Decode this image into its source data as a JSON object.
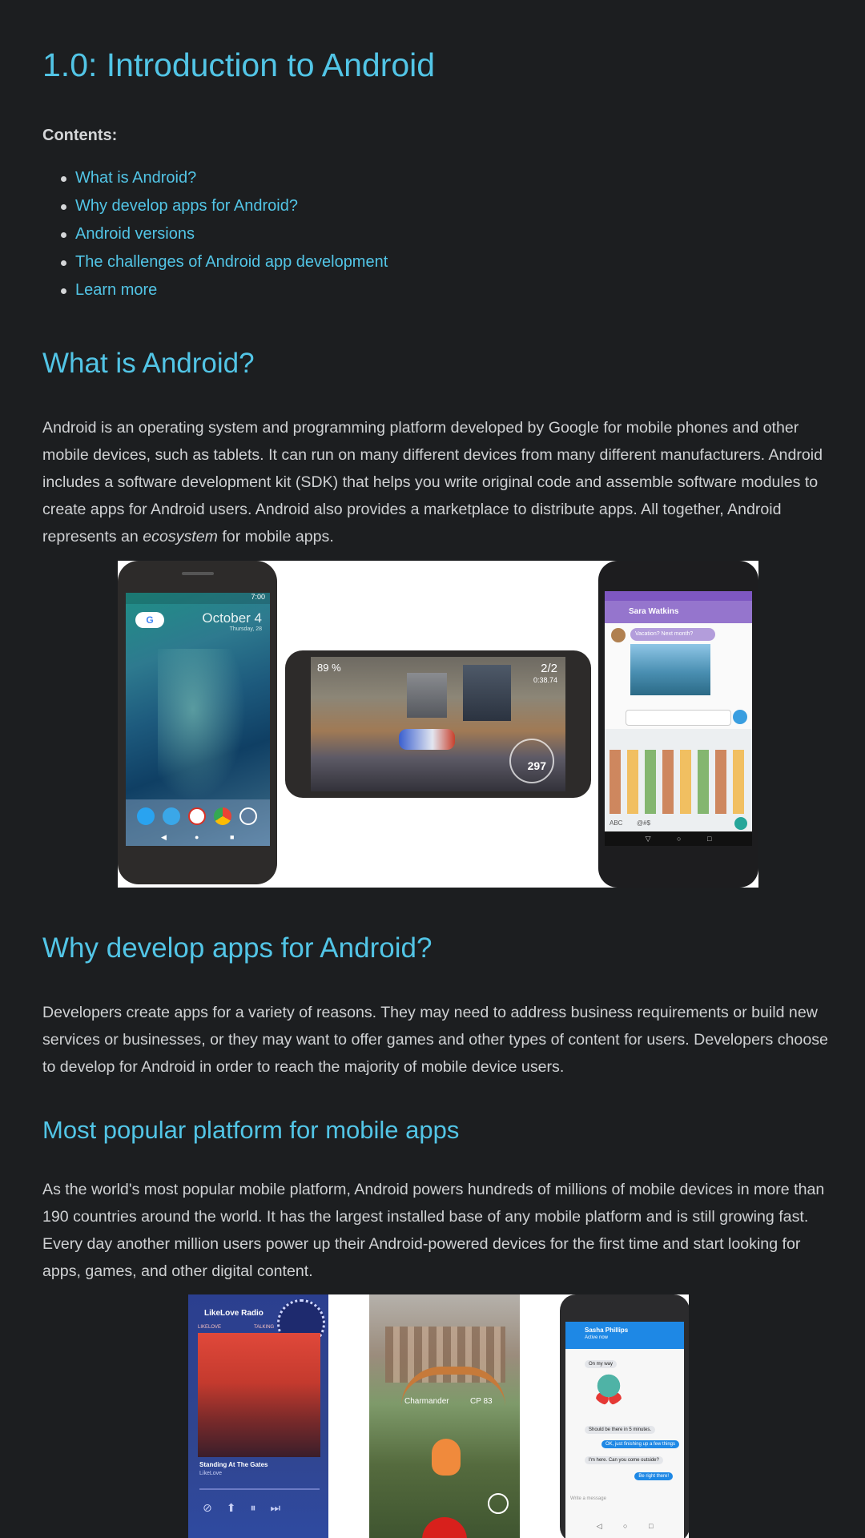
{
  "page": {
    "title": "1.0: Introduction to Android",
    "contents_label": "Contents:",
    "toc": [
      "What is Android?",
      "Why develop apps for Android?",
      "Android versions",
      "The challenges of Android app development",
      "Learn more"
    ]
  },
  "section_what": {
    "heading": "What is Android?",
    "para_before": "Android is an operating system and programming platform developed by Google for mobile phones and other mobile devices, such as tablets. It can run on many different devices from many different manufacturers. Android includes a software development kit (SDK) that helps you write original code and assemble software modules to create apps for Android users. Android also provides a marketplace to distribute apps. All together, Android represents an ",
    "para_emph": "ecosystem",
    "para_after": " for mobile apps."
  },
  "figure1": {
    "home_date": "October 4",
    "home_sub": "Thursday, 28",
    "status_time": "7:00",
    "game_pct": "89 %",
    "game_lap": "2/2",
    "game_time": "0:38.74",
    "game_speed": "297",
    "chat_name": "Sara Watkins",
    "chat_msg": "Vacation? Next month?",
    "emoji_keys": [
      "ABC",
      "@#$"
    ]
  },
  "section_why": {
    "heading": "Why develop apps for Android?",
    "para": "Developers create apps for a variety of reasons. They may need to address business requirements or build new services or businesses, or they may want to offer games and other types of content for users. Developers choose to develop for Android in order to reach the majority of mobile device users."
  },
  "section_popular": {
    "heading": "Most popular platform for mobile apps",
    "para": "As the world's most popular mobile platform, Android powers hundreds of millions of mobile devices in more than 190 countries around the world. It has the largest installed base of any mobile platform and is still growing fast. Every day another million users power up their Android-powered devices for the first time and start looking for apps, games, and other digital content."
  },
  "figure2": {
    "radio_title": "LikeLove Radio",
    "radio_tabs": [
      "LIKELOVE",
      "TALKING"
    ],
    "song_title": "Standing At The Gates",
    "song_artist": "LikeLove",
    "game_label": "Charmander",
    "game_cp": "CP 83",
    "chat_name": "Sasha Phillips",
    "chat_sub": "Active now",
    "chat_msgs": [
      "On my way",
      "Should be there in 5 minutes.",
      "OK, just finishing up a few things",
      "I'm here. Can you come outside?",
      "Be right there!"
    ],
    "chat_input": "Write a message"
  },
  "colors": {
    "background": "#1c1e20",
    "link": "#52c5e6",
    "text": "#cfd1d3"
  }
}
